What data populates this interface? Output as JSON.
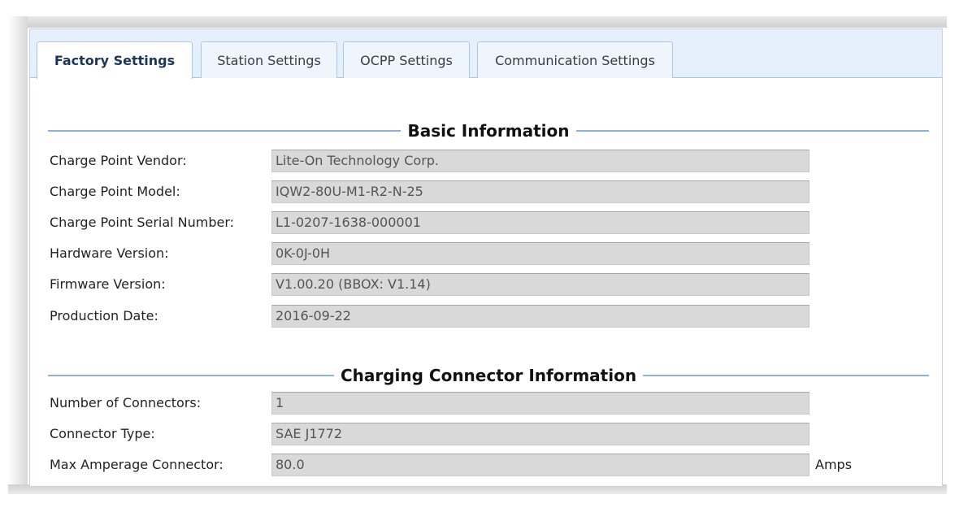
{
  "tabs": [
    {
      "label": "Factory Settings",
      "active": true
    },
    {
      "label": "Station Settings",
      "active": false
    },
    {
      "label": "OCPP Settings",
      "active": false
    },
    {
      "label": "Communication Settings",
      "active": false
    }
  ],
  "basic_info": {
    "title": "Basic Information",
    "rows": [
      {
        "label": "Charge Point Vendor:",
        "value": "Lite-On Technology Corp."
      },
      {
        "label": "Charge Point Model:",
        "value": "IQW2-80U-M1-R2-N-25"
      },
      {
        "label": "Charge Point Serial Number:",
        "value": "L1-0207-1638-000001"
      },
      {
        "label": "Hardware Version:",
        "value": "0K-0J-0H"
      },
      {
        "label": "Firmware Version:",
        "value": "V1.00.20 (BBOX: V1.14)"
      },
      {
        "label": "Production Date:",
        "value": "2016-09-22"
      }
    ]
  },
  "connector_info": {
    "title": "Charging Connector Information",
    "rows": [
      {
        "label": "Number of Connectors:",
        "value": "1"
      },
      {
        "label": "Connector Type:",
        "value": "SAE J1772"
      },
      {
        "label": "Max Amperage Connector:",
        "value": "80.0",
        "unit": "Amps"
      }
    ]
  },
  "colors": {
    "tab_strip": "#e6f0fc",
    "section_line": "#8eb2dd",
    "field_bg": "#d9d9d9"
  }
}
